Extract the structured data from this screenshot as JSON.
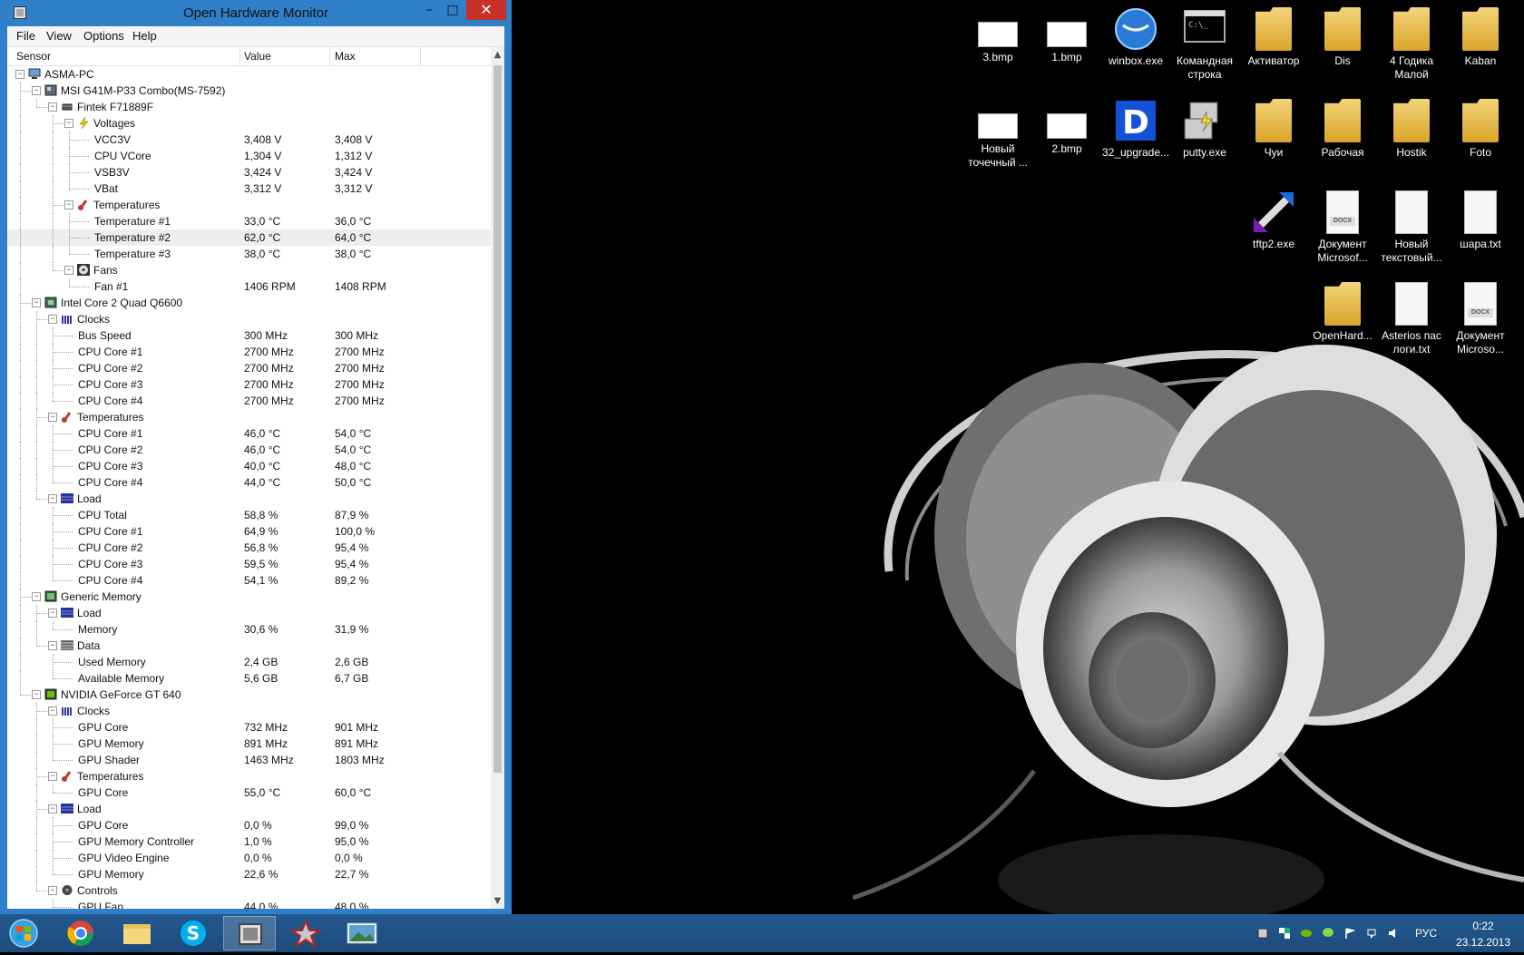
{
  "window": {
    "title": "Open Hardware Monitor",
    "minimize": "–",
    "maximize": "□",
    "close": "✕"
  },
  "menu": [
    "File",
    "View",
    "Options",
    "Help"
  ],
  "columns": {
    "sensor": "Sensor",
    "value": "Value",
    "max": "Max"
  },
  "tree": [
    {
      "level": 0,
      "label": "ASMA-PC",
      "icon": "computer-icon",
      "toggle": "−"
    },
    {
      "level": 1,
      "label": "MSI G41M-P33 Combo(MS-7592)",
      "icon": "motherboard-icon",
      "toggle": "−"
    },
    {
      "level": 2,
      "label": "Fintek F71889F",
      "icon": "chip-icon",
      "toggle": "−"
    },
    {
      "level": 3,
      "label": "Voltages",
      "icon": "lightning-icon",
      "toggle": "−"
    },
    {
      "level": 4,
      "label": "VCC3V",
      "value": "3,408 V",
      "max": "3,408 V"
    },
    {
      "level": 4,
      "label": "CPU VCore",
      "value": "1,304 V",
      "max": "1,312 V"
    },
    {
      "level": 4,
      "label": "VSB3V",
      "value": "3,424 V",
      "max": "3,424 V"
    },
    {
      "level": 4,
      "label": "VBat",
      "value": "3,312 V",
      "max": "3,312 V"
    },
    {
      "level": 3,
      "label": "Temperatures",
      "icon": "thermometer-icon",
      "toggle": "−"
    },
    {
      "level": 4,
      "label": "Temperature #1",
      "value": "33,0 °C",
      "max": "36,0 °C"
    },
    {
      "level": 4,
      "label": "Temperature #2",
      "value": "62,0 °C",
      "max": "64,0 °C",
      "highlight": true
    },
    {
      "level": 4,
      "label": "Temperature #3",
      "value": "38,0 °C",
      "max": "38,0 °C"
    },
    {
      "level": 3,
      "label": "Fans",
      "icon": "fan-icon",
      "toggle": "−"
    },
    {
      "level": 4,
      "label": "Fan #1",
      "value": "1406 RPM",
      "max": "1408 RPM"
    },
    {
      "level": 1,
      "label": "Intel Core 2 Quad Q6600",
      "icon": "cpu-icon",
      "toggle": "−"
    },
    {
      "level": 2,
      "label": "Clocks",
      "icon": "clock-bars-icon",
      "toggle": "−"
    },
    {
      "level": 3,
      "label": "Bus Speed",
      "value": "300 MHz",
      "max": "300 MHz"
    },
    {
      "level": 3,
      "label": "CPU Core #1",
      "value": "2700 MHz",
      "max": "2700 MHz"
    },
    {
      "level": 3,
      "label": "CPU Core #2",
      "value": "2700 MHz",
      "max": "2700 MHz"
    },
    {
      "level": 3,
      "label": "CPU Core #3",
      "value": "2700 MHz",
      "max": "2700 MHz"
    },
    {
      "level": 3,
      "label": "CPU Core #4",
      "value": "2700 MHz",
      "max": "2700 MHz"
    },
    {
      "level": 2,
      "label": "Temperatures",
      "icon": "thermometer-icon",
      "toggle": "−"
    },
    {
      "level": 3,
      "label": "CPU Core #1",
      "value": "46,0 °C",
      "max": "54,0 °C"
    },
    {
      "level": 3,
      "label": "CPU Core #2",
      "value": "46,0 °C",
      "max": "54,0 °C"
    },
    {
      "level": 3,
      "label": "CPU Core #3",
      "value": "40,0 °C",
      "max": "48,0 °C"
    },
    {
      "level": 3,
      "label": "CPU Core #4",
      "value": "44,0 °C",
      "max": "50,0 °C"
    },
    {
      "level": 2,
      "label": "Load",
      "icon": "load-icon",
      "toggle": "−"
    },
    {
      "level": 3,
      "label": "CPU Total",
      "value": "58,8 %",
      "max": "87,9 %"
    },
    {
      "level": 3,
      "label": "CPU Core #1",
      "value": "64,9 %",
      "max": "100,0 %"
    },
    {
      "level": 3,
      "label": "CPU Core #2",
      "value": "56,8 %",
      "max": "95,4 %"
    },
    {
      "level": 3,
      "label": "CPU Core #3",
      "value": "59,5 %",
      "max": "95,4 %"
    },
    {
      "level": 3,
      "label": "CPU Core #4",
      "value": "54,1 %",
      "max": "89,2 %"
    },
    {
      "level": 1,
      "label": "Generic Memory",
      "icon": "memory-icon",
      "toggle": "−"
    },
    {
      "level": 2,
      "label": "Load",
      "icon": "load-icon",
      "toggle": "−"
    },
    {
      "level": 3,
      "label": "Memory",
      "value": "30,6 %",
      "max": "31,9 %"
    },
    {
      "level": 2,
      "label": "Data",
      "icon": "data-icon",
      "toggle": "−"
    },
    {
      "level": 3,
      "label": "Used Memory",
      "value": "2,4 GB",
      "max": "2,6 GB"
    },
    {
      "level": 3,
      "label": "Available Memory",
      "value": "5,6 GB",
      "max": "6,7 GB"
    },
    {
      "level": 1,
      "label": "NVIDIA GeForce GT 640",
      "icon": "gpu-icon",
      "toggle": "−"
    },
    {
      "level": 2,
      "label": "Clocks",
      "icon": "clock-bars-icon",
      "toggle": "−"
    },
    {
      "level": 3,
      "label": "GPU Core",
      "value": "732 MHz",
      "max": "901 MHz"
    },
    {
      "level": 3,
      "label": "GPU Memory",
      "value": "891 MHz",
      "max": "891 MHz"
    },
    {
      "level": 3,
      "label": "GPU Shader",
      "value": "1463 MHz",
      "max": "1803 MHz"
    },
    {
      "level": 2,
      "label": "Temperatures",
      "icon": "thermometer-icon",
      "toggle": "−"
    },
    {
      "level": 3,
      "label": "GPU Core",
      "value": "55,0 °C",
      "max": "60,0 °C"
    },
    {
      "level": 2,
      "label": "Load",
      "icon": "load-icon",
      "toggle": "−"
    },
    {
      "level": 3,
      "label": "GPU Core",
      "value": "0,0 %",
      "max": "99,0 %"
    },
    {
      "level": 3,
      "label": "GPU Memory Controller",
      "value": "1,0 %",
      "max": "95,0 %"
    },
    {
      "level": 3,
      "label": "GPU Video Engine",
      "value": "0,0 %",
      "max": "0,0 %"
    },
    {
      "level": 3,
      "label": "GPU Memory",
      "value": "22,6 %",
      "max": "22,7 %"
    },
    {
      "level": 2,
      "label": "Controls",
      "icon": "controls-icon",
      "toggle": "−"
    },
    {
      "level": 3,
      "label": "GPU Fan",
      "value": "44,0 %",
      "max": "48,0 %"
    }
  ],
  "desktop_icons": [
    {
      "label": "3.bmp",
      "type": "bmp"
    },
    {
      "label": "1.bmp",
      "type": "bmp"
    },
    {
      "label": "winbox.exe",
      "type": "winbox"
    },
    {
      "label": "Командная строка",
      "type": "cmd"
    },
    {
      "label": "Активатор",
      "type": "folder"
    },
    {
      "label": "Dis",
      "type": "folder"
    },
    {
      "label": "4 Годика Малой",
      "type": "folder"
    },
    {
      "label": "Kaban",
      "type": "folder"
    },
    {
      "label": "Новый точечный ...",
      "type": "bmp"
    },
    {
      "label": "2.bmp",
      "type": "bmp"
    },
    {
      "label": "32_upgrade...",
      "type": "dexe"
    },
    {
      "label": "putty.exe",
      "type": "putty"
    },
    {
      "label": "Чуи",
      "type": "folder"
    },
    {
      "label": "Рабочая",
      "type": "folder"
    },
    {
      "label": "Hostik",
      "type": "folder"
    },
    {
      "label": "Foto",
      "type": "folder"
    },
    {
      "label": "tftp2.exe",
      "type": "tftp"
    },
    {
      "label": "Документ Microsof...",
      "type": "docx"
    },
    {
      "label": "Новый текстовый...",
      "type": "txt"
    },
    {
      "label": "шара.txt",
      "type": "txt"
    },
    {
      "label": "OpenHard...",
      "type": "folder"
    },
    {
      "label": "Asterios пас логи.txt",
      "type": "txt"
    },
    {
      "label": "Документ Microso...",
      "type": "docx"
    }
  ],
  "docx_tag": "DOCX",
  "taskbar": {
    "language": "РУС",
    "time": "0:22",
    "date": "23.12.2013"
  },
  "colors": {
    "window_frame": "#2f7fc9",
    "close_button": "#c7312a",
    "taskbar": "#1f4f80"
  }
}
